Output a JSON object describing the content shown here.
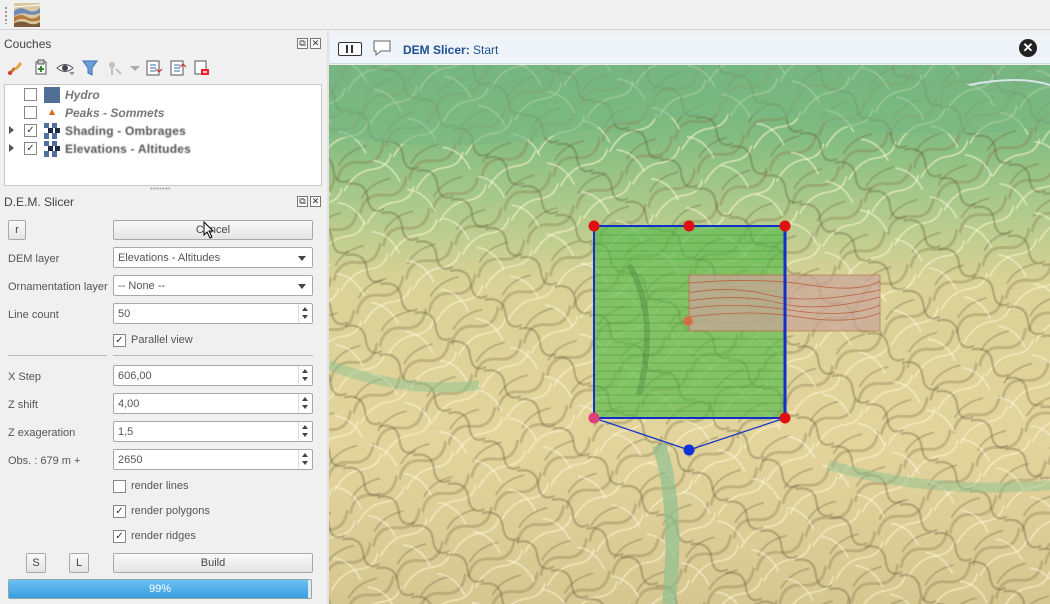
{
  "layers_panel": {
    "title": "Couches",
    "layers": [
      {
        "label": "Hydro",
        "checked": false,
        "expandable": false,
        "style": "italic",
        "symbol": "blue-square"
      },
      {
        "label": "Peaks - Sommets",
        "checked": false,
        "expandable": false,
        "style": "italic",
        "symbol": "peak-marker"
      },
      {
        "label": "Shading - Ombrages",
        "checked": true,
        "expandable": true,
        "style": "blur",
        "symbol": "raster"
      },
      {
        "label": "Elevations - Altitudes",
        "checked": true,
        "expandable": true,
        "style": "blur",
        "symbol": "raster"
      }
    ]
  },
  "dem_panel": {
    "title": "D.E.M. Slicer",
    "r_button": "r",
    "cancel_button": "Cancel",
    "dem_layer_label": "DEM layer",
    "dem_layer_value": "Elevations - Altitudes",
    "ornamentation_label": "Ornamentation layer",
    "ornamentation_value": "-- None --",
    "line_count_label": "Line count",
    "line_count_value": "50",
    "parallel_view_label": "Parallel view",
    "parallel_view_checked": true,
    "x_step_label": "X Step",
    "x_step_value": "606,00",
    "z_shift_label": "Z shift",
    "z_shift_value": "4,00",
    "z_exag_label": "Z exageration",
    "z_exag_value": "1,5",
    "obs_label": "Obs. : 679 m  +",
    "obs_value": "2650",
    "render_lines_label": "render lines",
    "render_lines_checked": false,
    "render_polygons_label": "render polygons",
    "render_polygons_checked": true,
    "render_ridges_label": "render ridges",
    "render_ridges_checked": true,
    "s_button": "S",
    "l_button": "L",
    "build_button": "Build",
    "progress_text": "99%",
    "progress_value": 0.99
  },
  "map_view": {
    "title_bold": "DEM Slicer:",
    "title_rest": " Start",
    "close_symbol": "✕"
  },
  "colors": {
    "accent": "#1f4f93",
    "progress": "#3a9de0",
    "slice_fill": "#53b84a",
    "frame": "#1030c8",
    "handle_red": "#e01010"
  }
}
